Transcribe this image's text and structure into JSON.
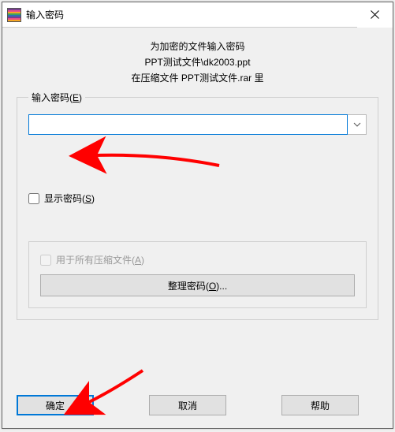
{
  "titlebar": {
    "title": "输入密码"
  },
  "header": {
    "line1": "为加密的文件输入密码",
    "line2": "PPT测试文件\\dk2003.ppt",
    "line3": "在压缩文件 PPT测试文件.rar 里"
  },
  "fieldset": {
    "label_prefix": "输入密码(",
    "label_key": "E",
    "label_suffix": ")",
    "password_value": "",
    "show_password_prefix": "显示密码(",
    "show_password_key": "S",
    "show_password_suffix": ")"
  },
  "subbox": {
    "all_archives_prefix": "用于所有压缩文件(",
    "all_archives_key": "A",
    "all_archives_suffix": ")",
    "organize_prefix": "整理密码(",
    "organize_key": "O",
    "organize_suffix": ")..."
  },
  "buttons": {
    "ok": "确定",
    "cancel": "取消",
    "help": "帮助"
  }
}
